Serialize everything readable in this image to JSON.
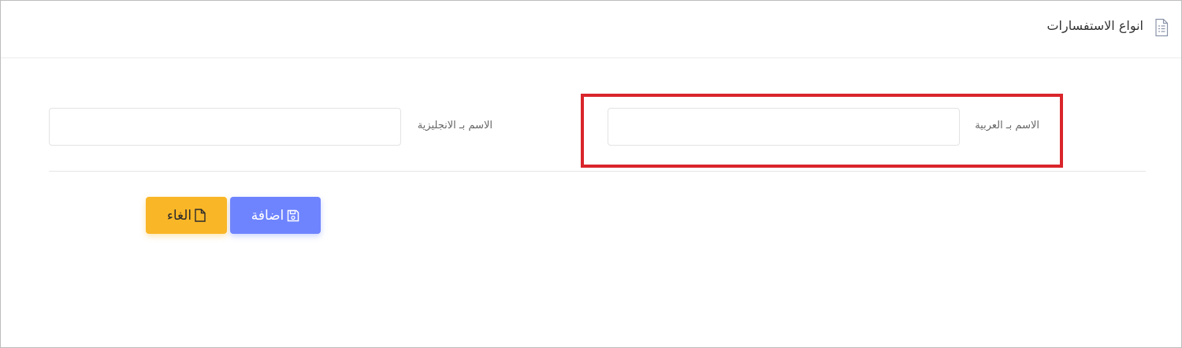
{
  "header": {
    "title": "انواع الاستفسارات",
    "icon": "document-list-icon"
  },
  "form": {
    "name_ar": {
      "label": "الاسم بـ العربية",
      "value": "",
      "placeholder": ""
    },
    "name_en": {
      "label": "الاسم بـ الانجليزية",
      "value": "",
      "placeholder": ""
    }
  },
  "actions": {
    "save_label": "اضافة",
    "save_icon": "floppy-disk-icon",
    "cancel_label": "الغاء",
    "cancel_icon": "file-icon"
  },
  "colors": {
    "save_button": "#6e84ff",
    "cancel_button": "#f9b627",
    "highlight": "#d9252b"
  }
}
